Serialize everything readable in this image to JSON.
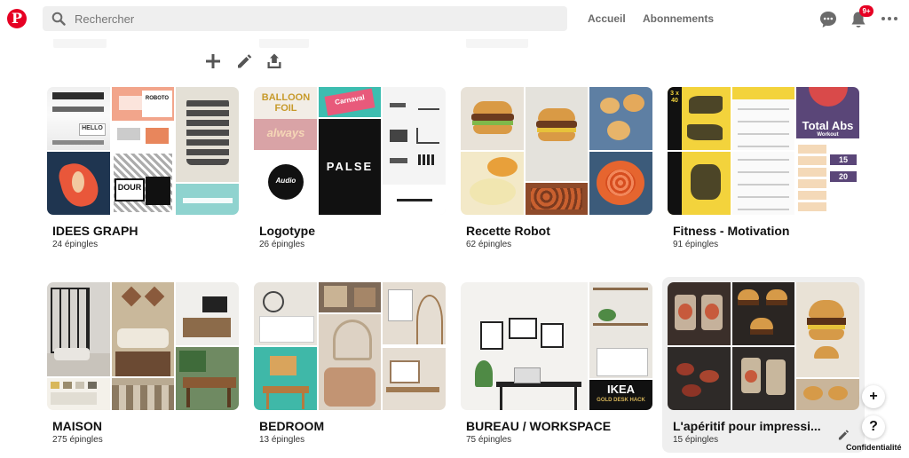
{
  "header": {
    "logo": "P",
    "search_placeholder": "Rechercher",
    "nav": [
      "Accueil",
      "Abonnements"
    ],
    "notifications_badge": "9+"
  },
  "icons": {
    "search": "search-icon",
    "messages": "chat-bubble-icon",
    "notifications": "bell-icon",
    "more": "more-horizontal-icon",
    "add": "plus-icon",
    "edit": "pencil-icon",
    "share": "share-icon",
    "help": "question-icon"
  },
  "colors": {
    "brand": "#e60023",
    "nav_text": "#6b6b6b",
    "search_bg": "#efefef"
  },
  "boards": [
    {
      "title": "IDEES GRAPH",
      "count": "24 épingles",
      "cover_texts": [
        "ROBOTO",
        "HELLO",
        "DOUR"
      ]
    },
    {
      "title": "Logotype",
      "count": "26 épingles",
      "cover_texts": [
        "BALLOON FOIL",
        "always",
        "PALSE",
        "Carnaval",
        "Audio"
      ]
    },
    {
      "title": "Recette Robot",
      "count": "62 épingles",
      "cover_texts": []
    },
    {
      "title": "Fitness - Motivation",
      "count": "91 épingles",
      "cover_texts": [
        "3 x 40",
        "Total Abs",
        "Workout",
        "15",
        "20"
      ]
    },
    {
      "title": "MAISON",
      "count": "275 épingles",
      "cover_texts": []
    },
    {
      "title": "BEDROOM",
      "count": "13 épingles",
      "cover_texts": []
    },
    {
      "title": "BUREAU / WORKSPACE",
      "count": "75 épingles",
      "cover_texts": [
        "IKEA",
        "GOLD DESK HACK"
      ]
    },
    {
      "title": "L'apéritif pour impressi...",
      "count": "15 épingles",
      "cover_texts": []
    }
  ],
  "floating": {
    "add": "+",
    "help": "?",
    "privacy": "Confidentialité"
  }
}
